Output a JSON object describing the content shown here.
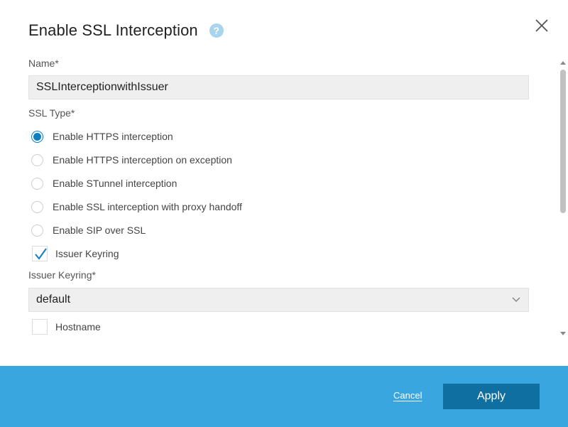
{
  "dialog": {
    "title": "Enable SSL Interception",
    "help_icon": "?",
    "close_icon": "close-icon"
  },
  "form": {
    "name_label": "Name*",
    "name_value": "SSLInterceptionwithIssuer",
    "ssl_type_label": "SSL Type*",
    "ssl_types": [
      {
        "label": "Enable HTTPS interception",
        "checked": true
      },
      {
        "label": "Enable HTTPS interception on exception",
        "checked": false
      },
      {
        "label": "Enable STunnel interception",
        "checked": false
      },
      {
        "label": "Enable SSL interception with proxy handoff",
        "checked": false
      },
      {
        "label": "Enable SIP over SSL",
        "checked": false
      }
    ],
    "issuer_keyring_checkbox": {
      "label": "Issuer Keyring",
      "checked": true
    },
    "issuer_keyring_label": "Issuer Keyring*",
    "issuer_keyring_value": "default",
    "hostname_checkbox": {
      "label": "Hostname",
      "checked": false
    }
  },
  "footer": {
    "cancel_label": "Cancel",
    "apply_label": "Apply"
  },
  "colors": {
    "accent": "#0d7fc0",
    "footer_bg": "#3aa6df",
    "apply_bg": "#0f6fa0"
  }
}
